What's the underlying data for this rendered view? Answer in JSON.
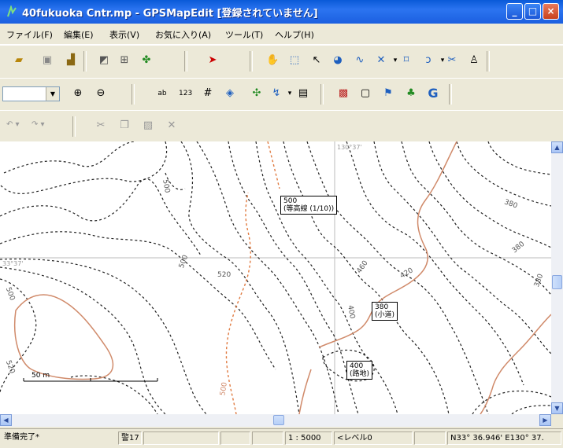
{
  "window": {
    "title": "40fukuoka Cntr.mp - GPSMapEdit [登録されていません]",
    "min_label": "_",
    "max_label": "□",
    "close_label": "×"
  },
  "menu": [
    "ファイル(F)",
    "編集(E)",
    "表示(V)",
    "お気に入り(A)",
    "ツール(T)",
    "ヘルプ(H)"
  ],
  "toolbar3": {
    "undo": "↶ ▾",
    "redo": "↷ ▾"
  },
  "map": {
    "coord_top": "130°37'",
    "coord_left": "33°37'",
    "contour_labels": [
      {
        "text": "500"
      },
      {
        "text": "500"
      },
      {
        "text": "520"
      },
      {
        "text": "460"
      },
      {
        "text": "420"
      },
      {
        "text": "380"
      },
      {
        "text": "380"
      },
      {
        "text": "400"
      },
      {
        "text": "380"
      },
      {
        "text": "500"
      },
      {
        "text": "520"
      },
      {
        "text": "500"
      }
    ],
    "boxes": [
      {
        "line1": "500",
        "line2": "(等高線 (1/10))"
      },
      {
        "line1": "380",
        "line2": "(小道)"
      },
      {
        "line1": "400",
        "line2": "(路地)"
      }
    ],
    "scale_label": "50 m"
  },
  "status": {
    "ready": "準備完了*",
    "warn": "警17",
    "scale": "1 : 5000",
    "level": "<レベル0",
    "coords": "N33° 36.946' E130° 37."
  }
}
